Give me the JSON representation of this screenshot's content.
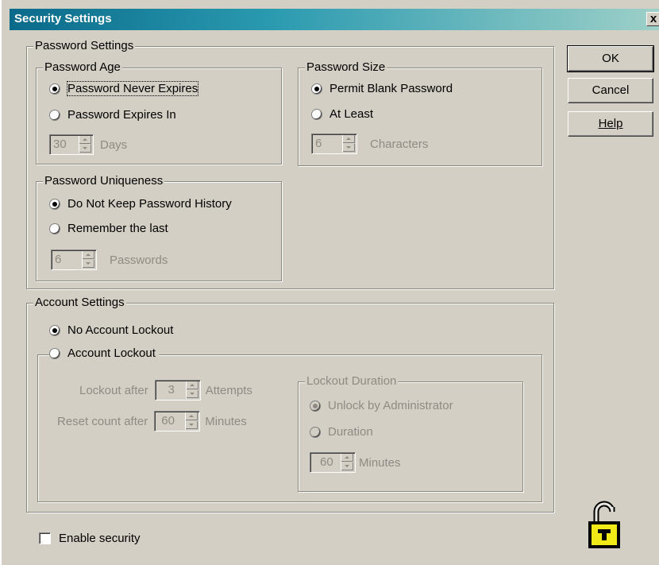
{
  "window": {
    "title": "Security Settings",
    "close_glyph": "x"
  },
  "buttons": {
    "ok": "OK",
    "cancel": "Cancel",
    "help": "Help"
  },
  "password_settings": {
    "legend": "Password Settings",
    "age": {
      "legend": "Password Age",
      "never_expires": "Password Never Expires",
      "expires_in": "Password Expires In",
      "days_value": "30",
      "days_label": "Days",
      "selected": "never_expires"
    },
    "size": {
      "legend": "Password Size",
      "permit_blank": "Permit Blank Password",
      "at_least": "At Least",
      "chars_value": "6",
      "chars_label": "Characters",
      "selected": "permit_blank"
    },
    "uniqueness": {
      "legend": "Password Uniqueness",
      "no_history": "Do Not Keep Password History",
      "remember_last": "Remember the last",
      "passwords_value": "6",
      "passwords_label": "Passwords",
      "selected": "no_history"
    }
  },
  "account_settings": {
    "legend": "Account Settings",
    "no_lockout": "No Account Lockout",
    "lockout": "Account Lockout",
    "selected": "no_lockout",
    "lockout_after_label": "Lockout after",
    "lockout_after_value": "3",
    "lockout_after_unit": "Attempts",
    "reset_label": "Reset count after",
    "reset_value": "60",
    "reset_unit": "Minutes",
    "duration": {
      "legend": "Lockout Duration",
      "unlock_admin": "Unlock by Administrator",
      "duration": "Duration",
      "minutes_value": "60",
      "minutes_label": "Minutes",
      "selected": "unlock_admin"
    }
  },
  "enable_security": {
    "label": "Enable security",
    "checked": false
  },
  "icons": {
    "lock": "padlock-open-icon",
    "close": "close-icon"
  },
  "colors": {
    "face": "#d4cfc4",
    "title_start": "#0a6a8a",
    "lock_yellow": "#f2ea16"
  }
}
